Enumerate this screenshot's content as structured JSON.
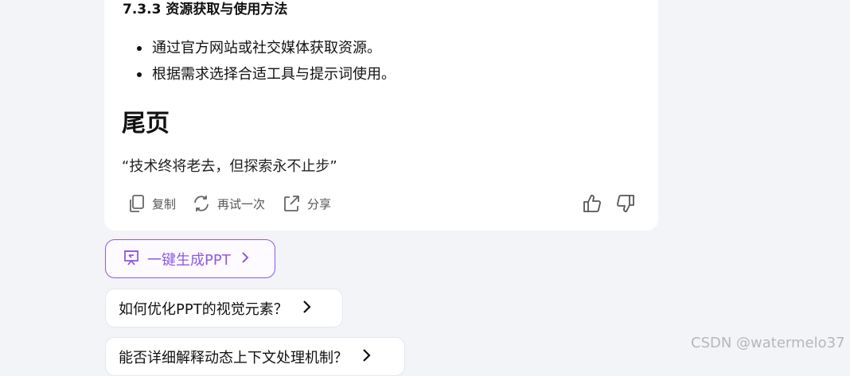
{
  "content": {
    "section_heading": "7.3.3 资源获取与使用方法",
    "bullets": [
      "通过官方网站或社交媒体获取资源。",
      "根据需求选择合适工具与提示词使用。"
    ],
    "page_title": "尾页",
    "quote": "“技术终将老去，但探索永不止步”"
  },
  "actions": {
    "copy_label": "复制",
    "retry_label": "再试一次",
    "share_label": "分享",
    "copy_icon": "copy-icon",
    "retry_icon": "refresh-icon",
    "share_icon": "share-icon",
    "like_icon": "thumbs-up-icon",
    "dislike_icon": "thumbs-down-icon"
  },
  "ppt_button": {
    "label": "一键生成PPT",
    "icon": "presentation-icon",
    "color": "#8f58e6"
  },
  "suggestions": [
    "如何优化PPT的视觉元素？",
    "能否详细解释动态上下文处理机制？"
  ],
  "watermark": "CSDN @watermelo37"
}
